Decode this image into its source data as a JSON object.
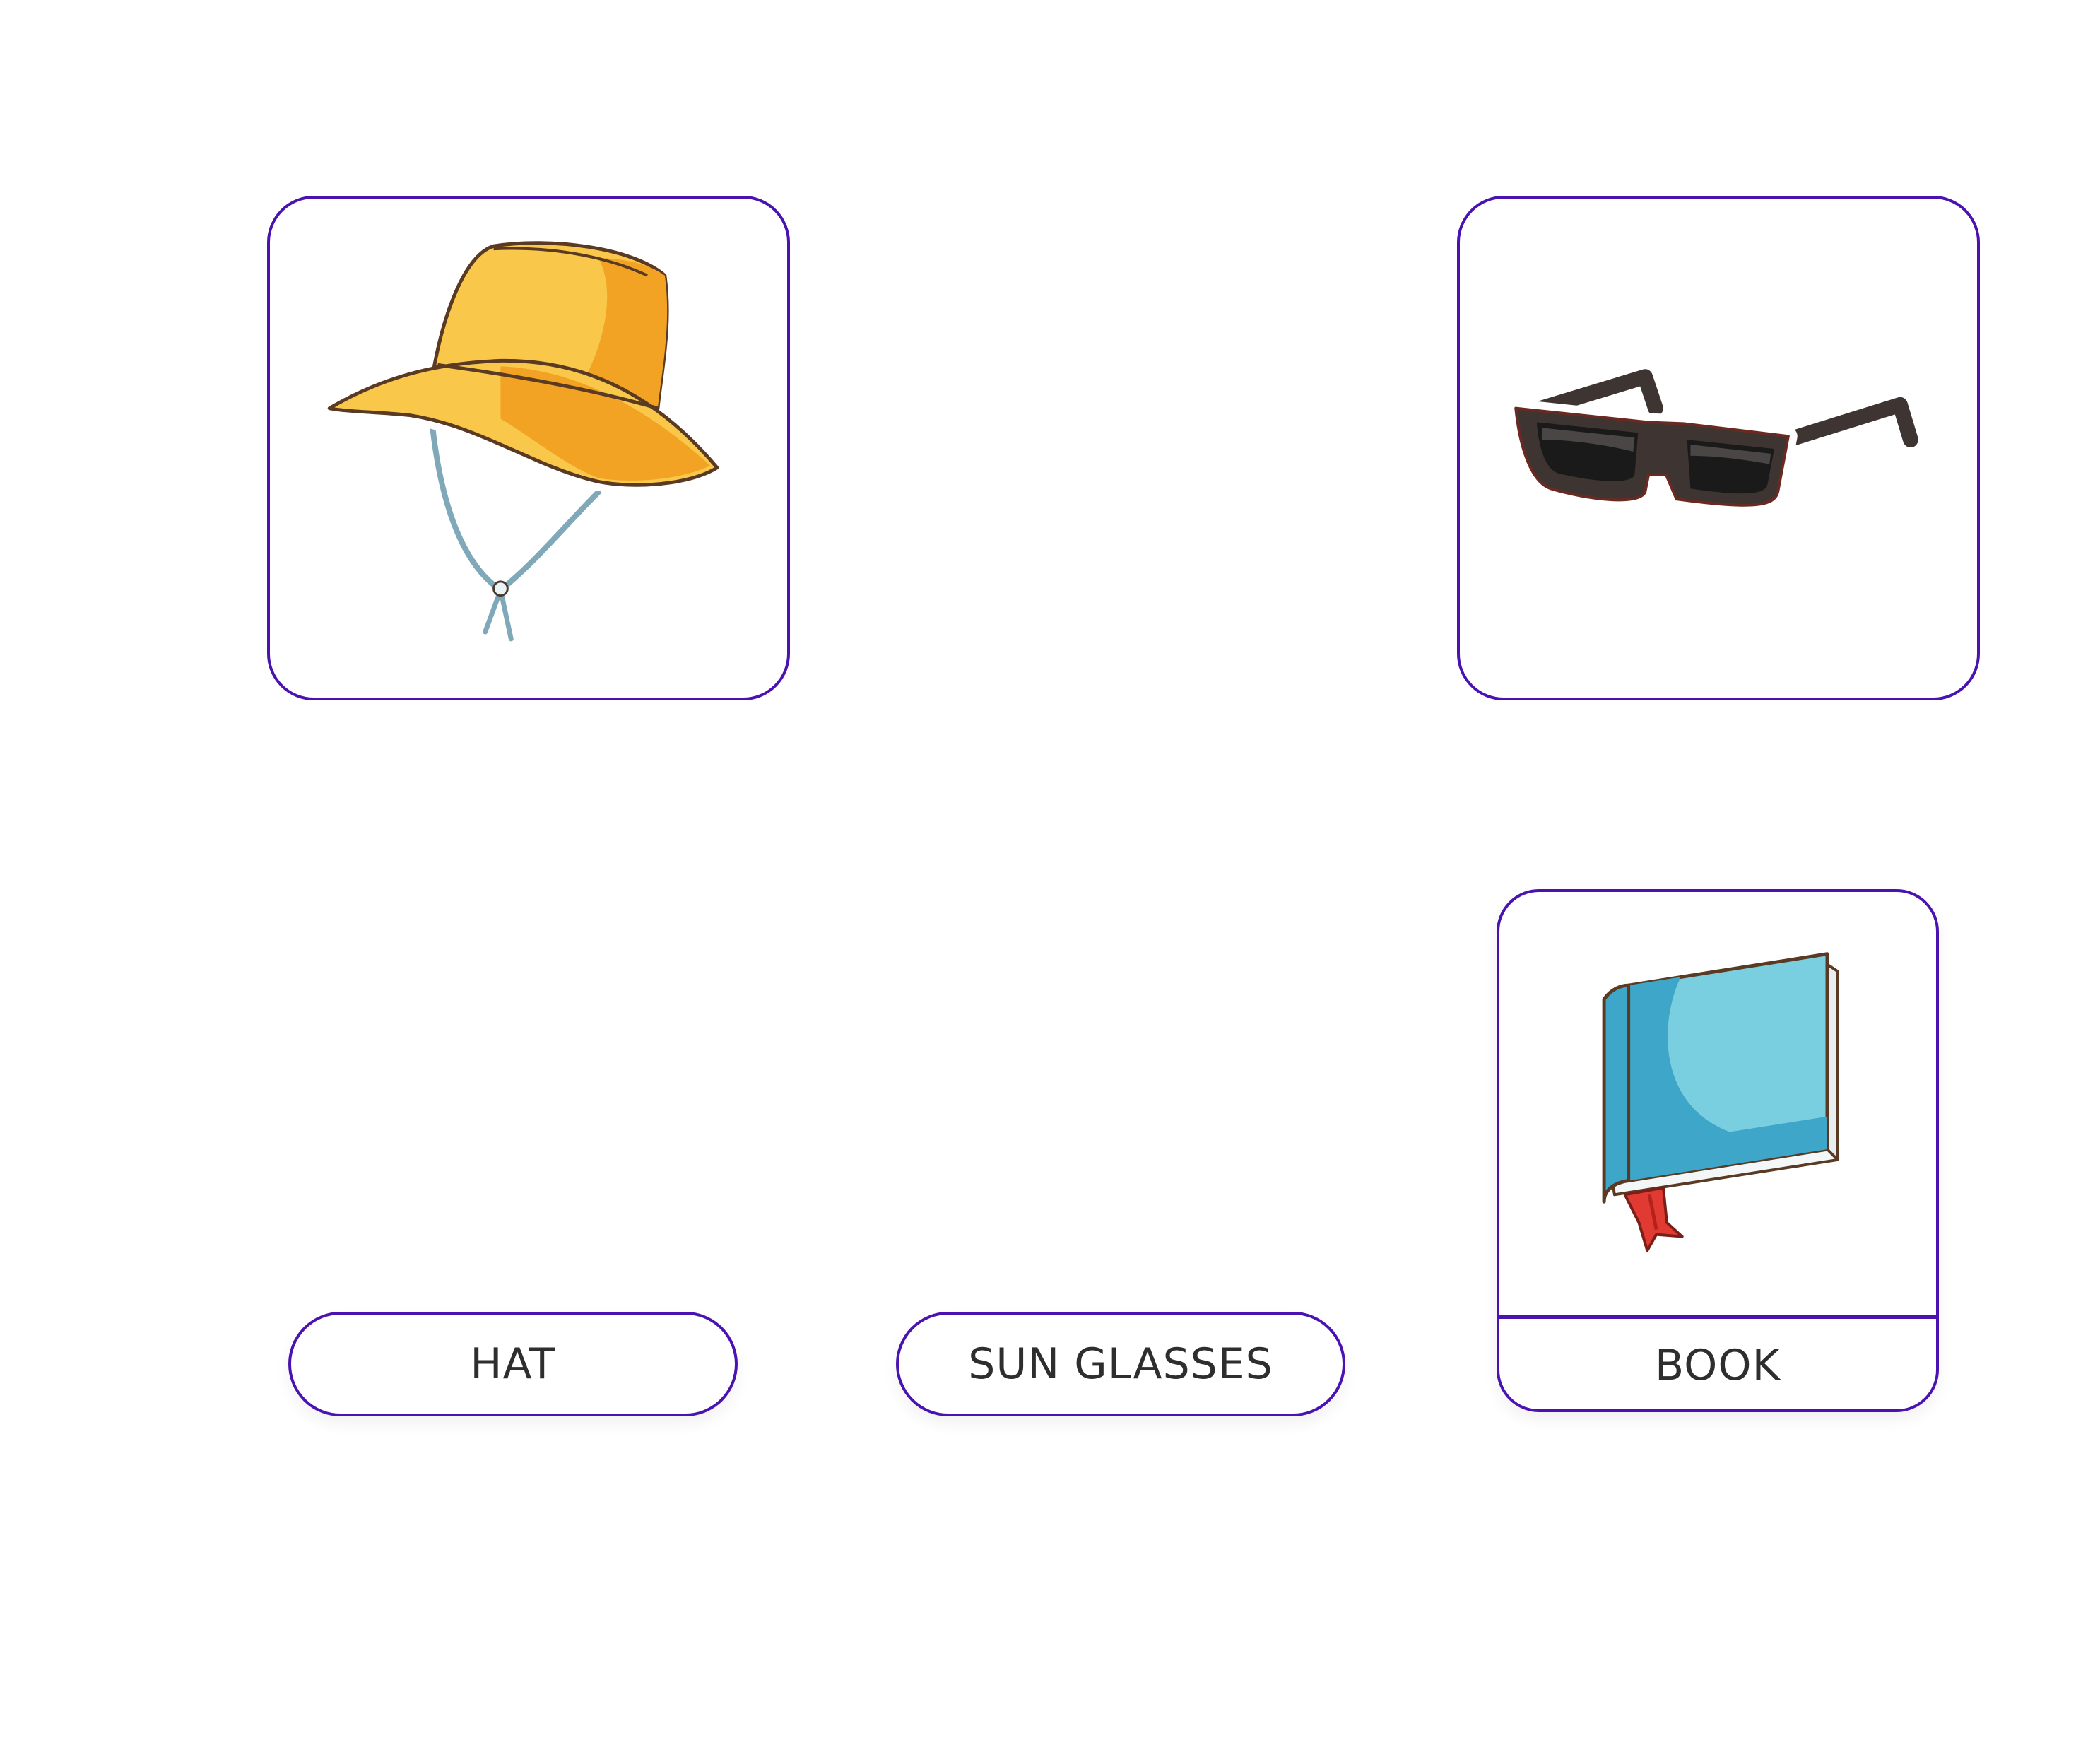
{
  "cards": {
    "hat": {
      "icon": "bucket-hat-icon"
    },
    "sunglasses": {
      "icon": "sunglasses-icon"
    }
  },
  "labels": {
    "hat": "HAT",
    "sunglasses": "SUN GLASSES"
  },
  "matched": {
    "book": {
      "icon": "book-icon",
      "label": "BOOK"
    }
  },
  "colors": {
    "border": "#4a12b0",
    "text": "#2e2e2e",
    "background": "#ffffff"
  }
}
